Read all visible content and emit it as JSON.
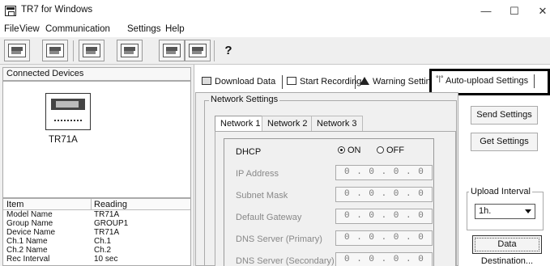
{
  "window": {
    "title": "TR7 for Windows",
    "minimize": "—",
    "maximize": "☐",
    "close": "✕"
  },
  "menu": [
    "File",
    "View",
    "Communication",
    "Settings",
    "Help"
  ],
  "toolbar": {
    "buttons": [
      "tr7-icon",
      "device-icon",
      "data-icon",
      "now-icon",
      "grid-icon"
    ],
    "help_glyph": "?"
  },
  "left_pane": {
    "header": "Connected Devices",
    "device_name": "TR71A",
    "table_headers": [
      "Item",
      "Reading"
    ],
    "rows": [
      {
        "item": "Model Name",
        "reading": "TR71A"
      },
      {
        "item": "Group Name",
        "reading": "GROUP1"
      },
      {
        "item": "Device Name",
        "reading": "TR71A"
      },
      {
        "item": "Ch.1 Name",
        "reading": "Ch.1"
      },
      {
        "item": "Ch.2 Name",
        "reading": "Ch.2"
      },
      {
        "item": "Rec Interval",
        "reading": "10 sec"
      }
    ]
  },
  "tabs": {
    "download": "Download Data",
    "recording": "Start Recording",
    "warning": "Warning Settings",
    "autoupload_icon": "°|°",
    "autoupload": "Auto-upload Settings"
  },
  "network": {
    "group_title": "Network Settings",
    "tabs": [
      "Network 1",
      "Network 2",
      "Network 3"
    ],
    "dhcp_label": "DHCP",
    "dhcp_on": "ON",
    "dhcp_off": "OFF",
    "dhcp_selected": "ON",
    "fields": [
      {
        "label": "IP Address",
        "value": "0 . 0 . 0 . 0"
      },
      {
        "label": "Subnet Mask",
        "value": "0 . 0 . 0 . 0"
      },
      {
        "label": "Default Gateway",
        "value": "0 . 0 . 0 . 0"
      },
      {
        "label": "DNS Server (Primary)",
        "value": "0 . 0 . 0 . 0"
      },
      {
        "label": "DNS Server (Secondary)",
        "value": "0 . 0 . 0 . 0"
      }
    ]
  },
  "side": {
    "send": "Send Settings",
    "get": "Get Settings",
    "interval_title": "Upload Interval",
    "interval_value": "1h.",
    "data_destination": "Data Destination..."
  }
}
